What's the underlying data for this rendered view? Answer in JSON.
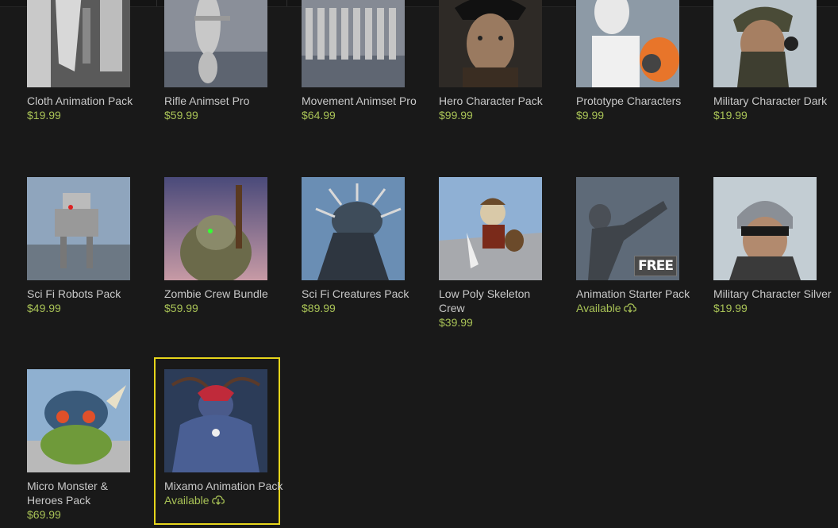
{
  "items": [
    {
      "title": "Cloth Animation Pack",
      "price": "$19.99"
    },
    {
      "title": "Rifle Animset Pro",
      "price": "$59.99"
    },
    {
      "title": "Movement Animset Pro",
      "price": "$64.99"
    },
    {
      "title": "Hero Character Pack",
      "price": "$99.99"
    },
    {
      "title": "Prototype Characters",
      "price": "$9.99"
    },
    {
      "title": "Military Character Dark",
      "price": "$19.99"
    },
    {
      "title": "Sci Fi Robots Pack",
      "price": "$49.99"
    },
    {
      "title": "Zombie Crew Bundle",
      "price": "$59.99"
    },
    {
      "title": "Sci Fi Creatures Pack",
      "price": "$89.99"
    },
    {
      "title": "Low Poly Skeleton Crew",
      "price": "$39.99"
    },
    {
      "title": "Animation Starter Pack",
      "price": "Available",
      "badge": "FREE"
    },
    {
      "title": "Military Character Silver",
      "price": "$19.99"
    },
    {
      "title": "Micro Monster & Heroes Pack",
      "price": "$69.99"
    },
    {
      "title": "Mixamo Animation Pack",
      "price": "Available"
    }
  ],
  "colors": {
    "accent_price": "#a8c256",
    "selection": "#e6d51b"
  }
}
